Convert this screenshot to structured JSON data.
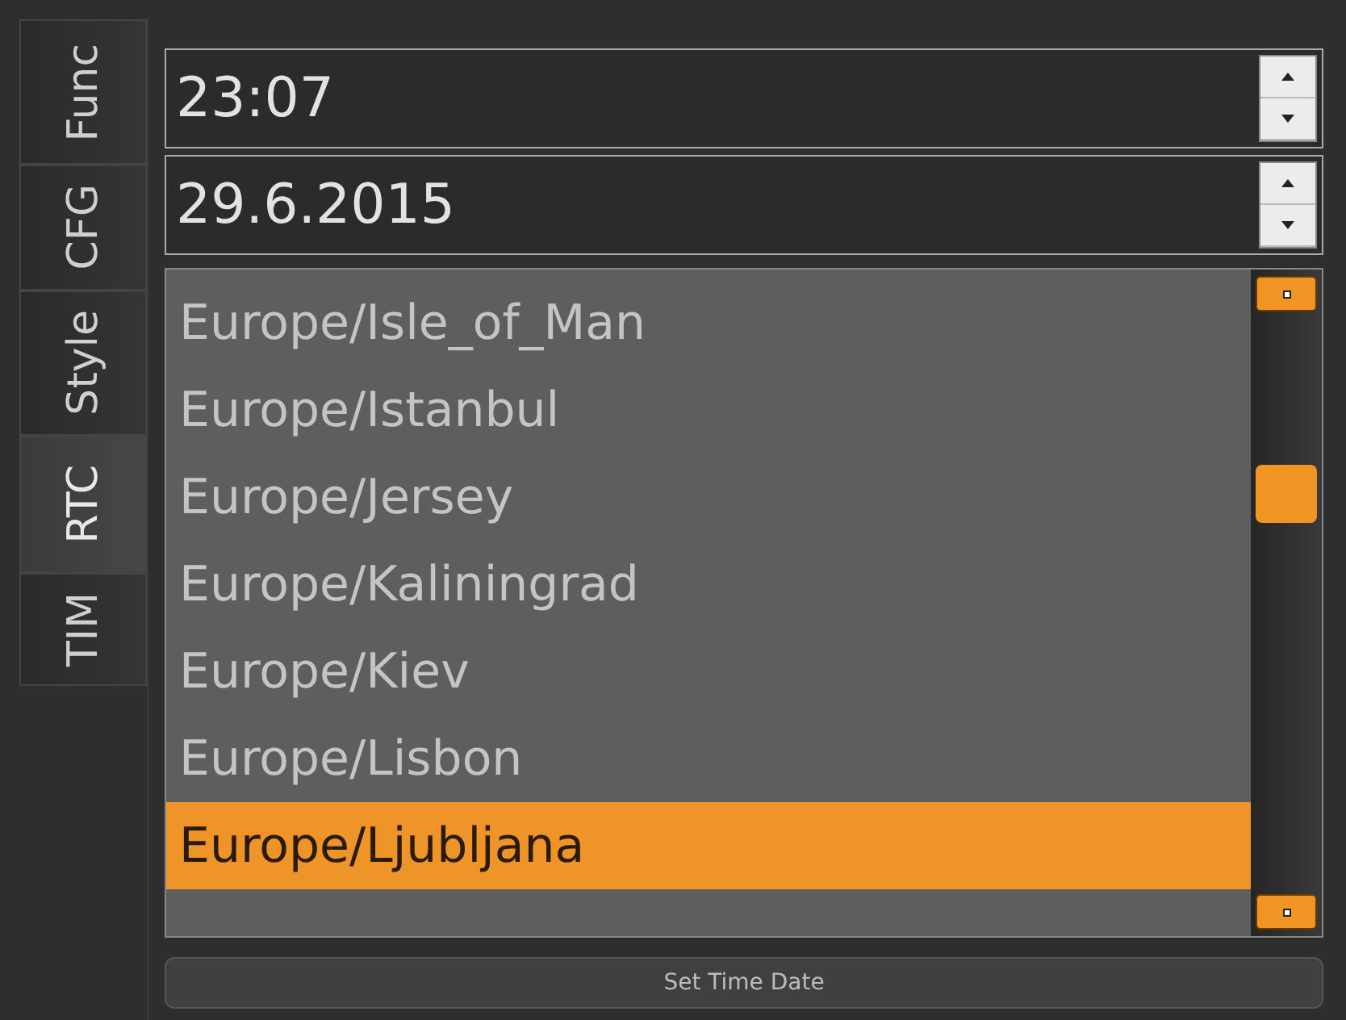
{
  "tabs": [
    {
      "label": "Func",
      "selected": false
    },
    {
      "label": "CFG",
      "selected": false
    },
    {
      "label": "Style",
      "selected": false
    },
    {
      "label": "RTC",
      "selected": true
    },
    {
      "label": "TIM",
      "selected": false
    }
  ],
  "time_field": {
    "value": "23:07"
  },
  "date_field": {
    "value": "29.6.2015"
  },
  "timezone_list": [
    {
      "label": "Europe/Isle_of_Man",
      "selected": false
    },
    {
      "label": "Europe/Istanbul",
      "selected": false
    },
    {
      "label": "Europe/Jersey",
      "selected": false
    },
    {
      "label": "Europe/Kaliningrad",
      "selected": false
    },
    {
      "label": "Europe/Kiev",
      "selected": false
    },
    {
      "label": "Europe/Lisbon",
      "selected": false
    },
    {
      "label": "Europe/Ljubljana",
      "selected": true
    }
  ],
  "button": "Set Time Date"
}
